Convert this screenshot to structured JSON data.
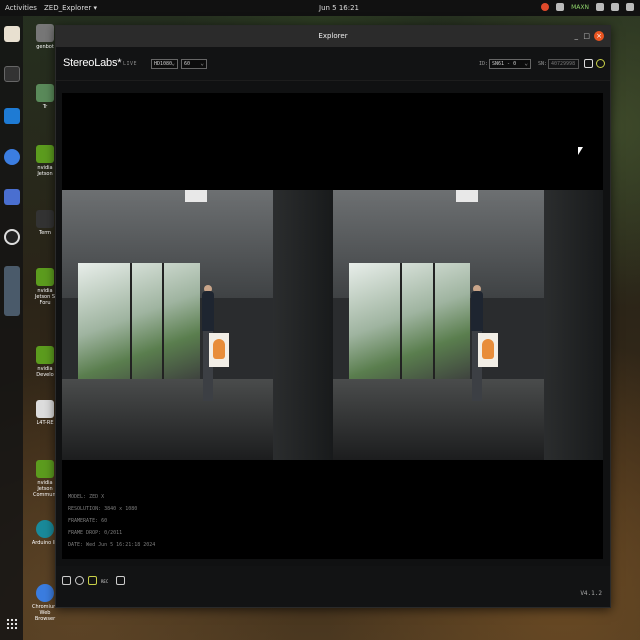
{
  "topbar": {
    "activities": "Activities",
    "app_menu": "ZED_Explorer ▾",
    "clock": "Jun 5  16:21",
    "maxn_label": "MAXN"
  },
  "dock": {
    "icons": [
      "files-icon",
      "terminal-icon",
      "vscode-icon",
      "chromium-icon",
      "screenshot-icon",
      "obs-icon",
      "app-grid-icon"
    ]
  },
  "desktop": {
    "icons": [
      {
        "label": "genbot",
        "name": "home-icon"
      },
      {
        "label": "Tr",
        "name": "trash-icon"
      },
      {
        "label": "nvidia Jetson",
        "name": "nvidia-icon"
      },
      {
        "label": "Term",
        "name": "terminal-icon"
      },
      {
        "label": "nvidia Jetson S Foru",
        "name": "nvidia-forum-icon"
      },
      {
        "label": "nvidia Develo",
        "name": "nvidia-dev-icon"
      },
      {
        "label": "L4T-RE",
        "name": "doc-icon"
      },
      {
        "label": "nvidia Jetson Communi",
        "name": "nvidia-community-icon"
      },
      {
        "label": "Arduino ID",
        "name": "arduino-icon"
      },
      {
        "label": "Chromium Web Browser",
        "name": "chromium-icon"
      }
    ]
  },
  "window": {
    "title": "Explorer",
    "minimize": "_",
    "maximize": "□",
    "close": "×"
  },
  "app": {
    "logo": "StereoLabs*",
    "live": "LIVE",
    "resolution_select": "HD1080",
    "fps_select": "60",
    "id_label": "ID:",
    "id_select": "SN61 - 0",
    "sn_label": "SN:",
    "sn_value": "40729998"
  },
  "metadata": {
    "model": "MODEL: ZED X",
    "resolution": "RESOLUTION: 3840 x 1080",
    "framerate": "FRAMERATE: 60",
    "frame_drop": "FRAME DROP: 0/2011",
    "date": "DATE: Wed Jun 5 16:21:18 2024"
  },
  "footer": {
    "rec_label": "REC",
    "version": "V4.1.2"
  },
  "colors": {
    "close_button": "#e95420",
    "accent_green": "#8fd46a"
  }
}
